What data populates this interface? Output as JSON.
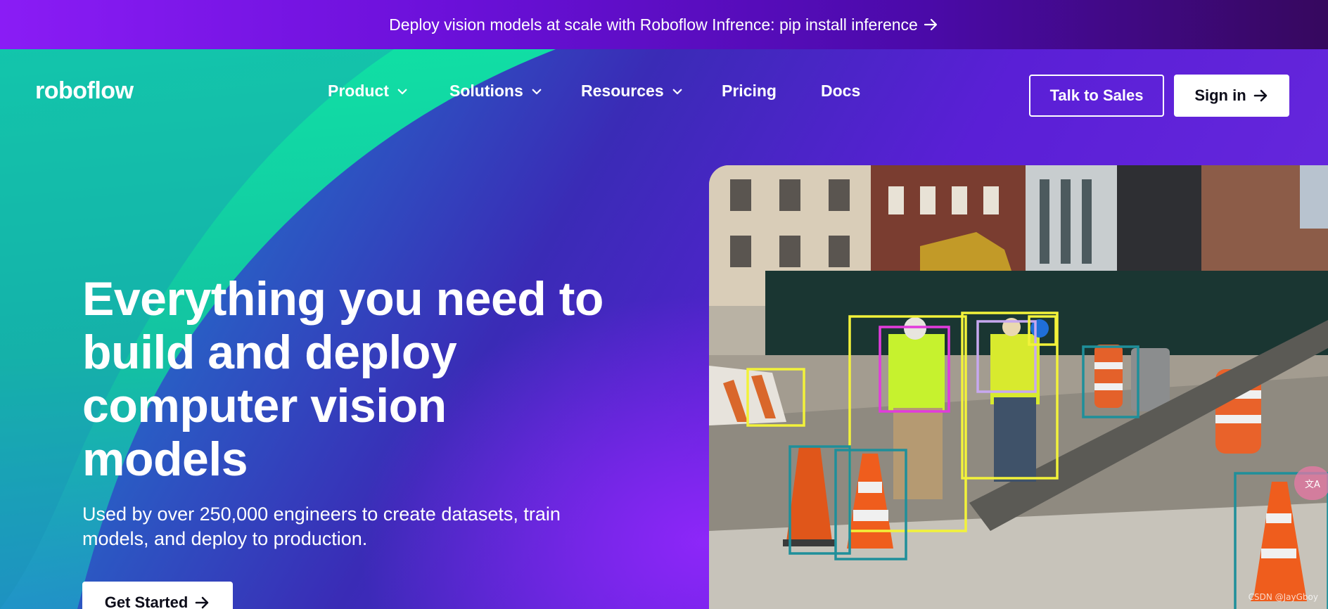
{
  "announcement": {
    "text": "Deploy vision models at scale with Roboflow Infrence: pip install inference",
    "icon": "arrow-right-icon"
  },
  "header": {
    "logo": "roboflow",
    "nav": [
      {
        "label": "Product",
        "dropdown": true
      },
      {
        "label": "Solutions",
        "dropdown": true
      },
      {
        "label": "Resources",
        "dropdown": true
      },
      {
        "label": "Pricing",
        "dropdown": false
      },
      {
        "label": "Docs",
        "dropdown": false
      }
    ],
    "talk_to_sales": "Talk to Sales",
    "sign_in": "Sign in"
  },
  "hero": {
    "headline": "Everything you need to build and deploy computer vision models",
    "subline": "Used by over 250,000 engineers to create datasets, train models, and deploy to production.",
    "cta": "Get Started"
  },
  "media": {
    "watermark": "CSDN @JayGboy",
    "translate_badge": "文A"
  },
  "colors": {
    "accent_green": "#12e3a4",
    "purple": "#6a10d8",
    "box_yellow": "#f2f23a",
    "box_magenta": "#e23bdc",
    "box_teal": "#1f8f9a",
    "box_lavender": "#c7a8f0"
  }
}
